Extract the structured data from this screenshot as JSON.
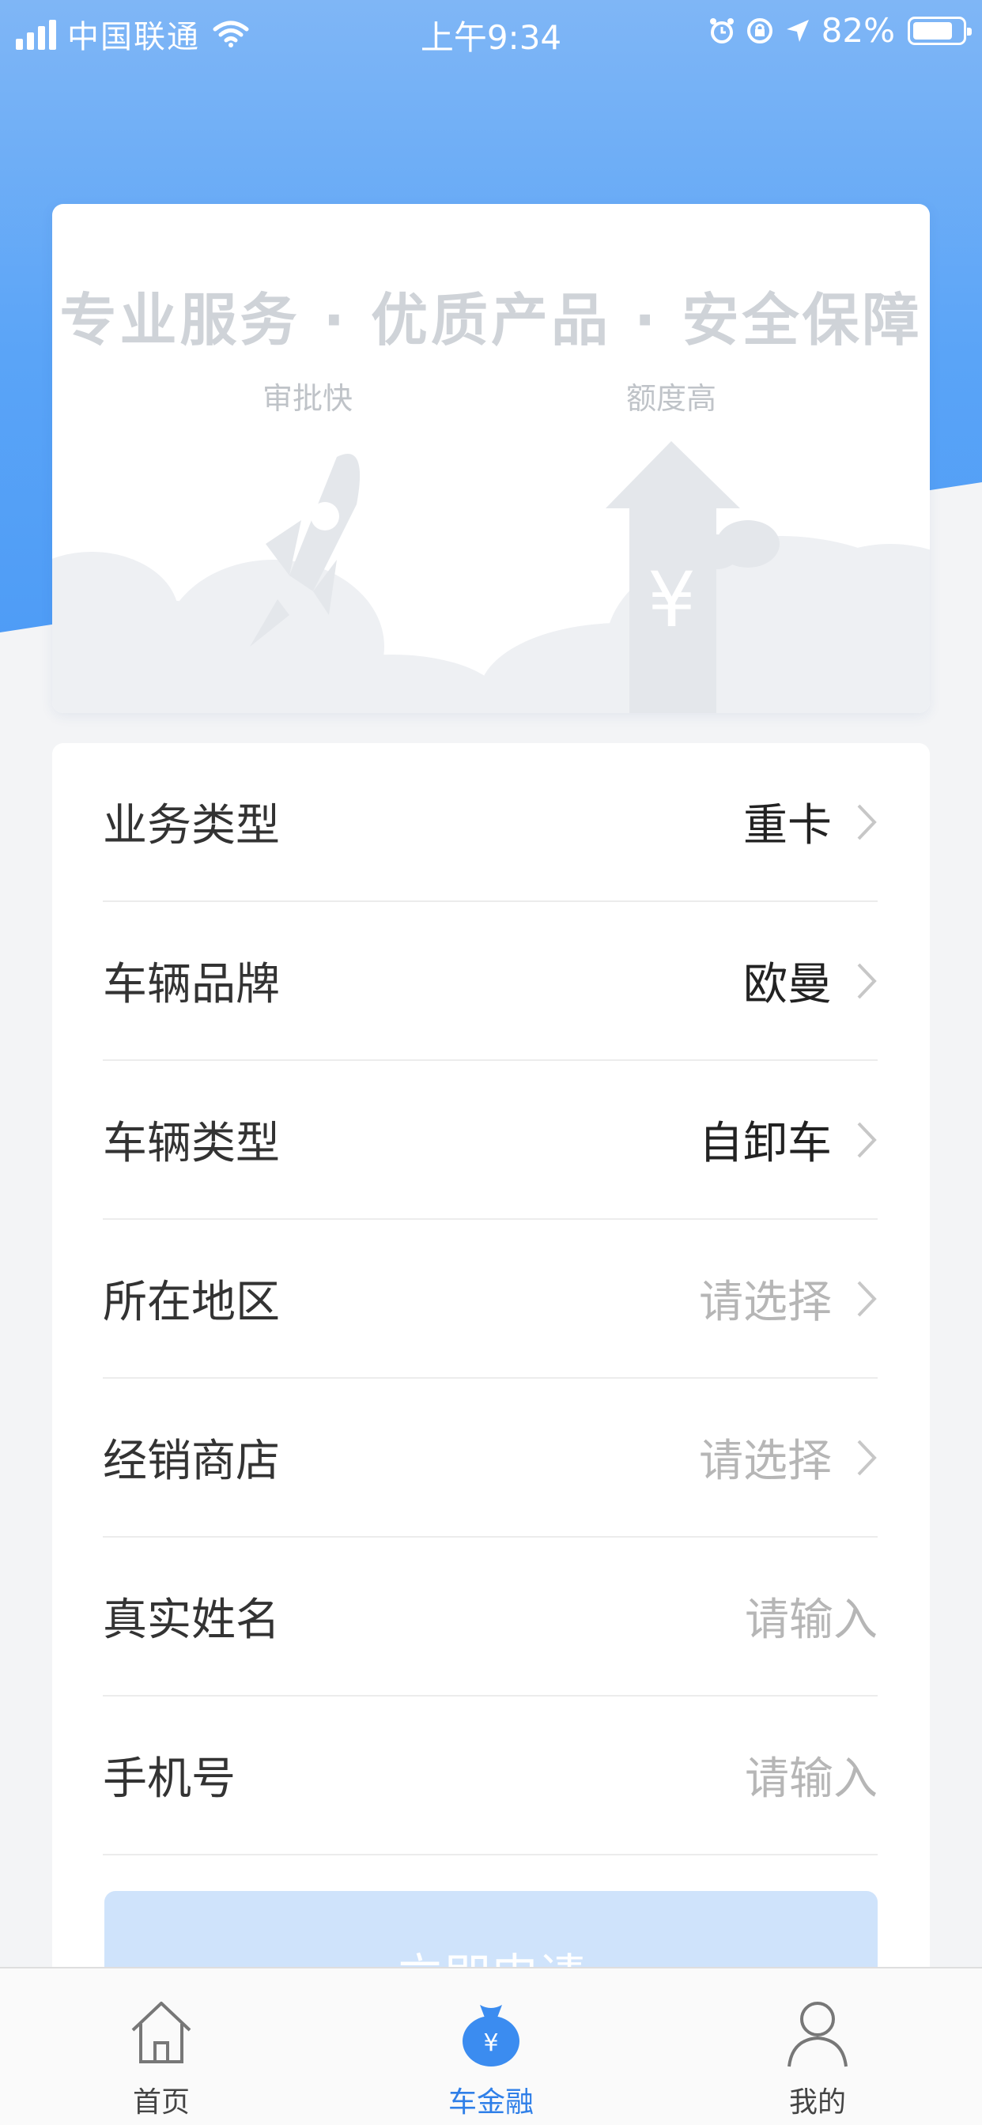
{
  "status_bar": {
    "carrier": "中国联通",
    "time": "上午9:34",
    "battery_percent": "82%",
    "battery_level": 0.82
  },
  "banner": {
    "title": "专业服务 · 优质产品 · 安全保障",
    "feature_left": "审批快",
    "feature_right": "额度高",
    "currency_symbol": "¥"
  },
  "form": {
    "rows": [
      {
        "label": "业务类型",
        "value": "重卡",
        "placeholder": false,
        "has_chevron": true
      },
      {
        "label": "车辆品牌",
        "value": "欧曼",
        "placeholder": false,
        "has_chevron": true
      },
      {
        "label": "车辆类型",
        "value": "自卸车",
        "placeholder": false,
        "has_chevron": true
      },
      {
        "label": "所在地区",
        "value": "请选择",
        "placeholder": true,
        "has_chevron": true
      },
      {
        "label": "经销商店",
        "value": "请选择",
        "placeholder": true,
        "has_chevron": true
      },
      {
        "label": "真实姓名",
        "value": "请输入",
        "placeholder": true,
        "has_chevron": false
      },
      {
        "label": "手机号",
        "value": "请输入",
        "placeholder": true,
        "has_chevron": false
      }
    ],
    "submit_label": "立即申请"
  },
  "tab_bar": {
    "tabs": [
      {
        "label": "首页",
        "icon": "home-icon",
        "active": false
      },
      {
        "label": "车金融",
        "icon": "money-bag-icon",
        "active": true
      },
      {
        "label": "我的",
        "icon": "profile-icon",
        "active": false
      }
    ]
  },
  "colors": {
    "accent": "#2f7fe8",
    "header_blue": "#5aa4f7",
    "placeholder_text": "#b6b6b6"
  }
}
